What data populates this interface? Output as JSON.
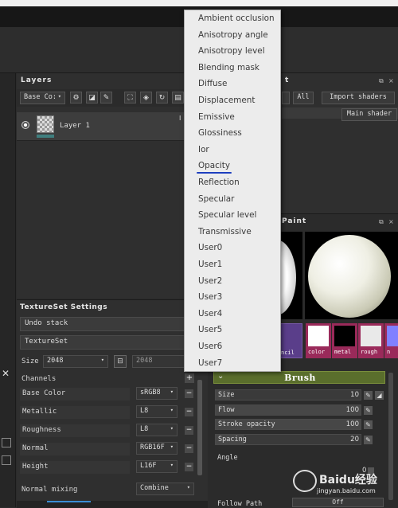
{
  "layers_panel": {
    "title": "Layers",
    "channel_select": "Base Co:",
    "layer_name": "Layer 1",
    "marker": "I"
  },
  "texture_panel": {
    "title": "TextureSet Settings",
    "undo_stack": "Undo stack",
    "textureset": "TextureSet",
    "size_label": "Size",
    "size_value": "2048",
    "size_value2": "2048",
    "channels_label": "Channels",
    "channels": [
      {
        "name": "Base Color",
        "format": "sRGB8"
      },
      {
        "name": "Metallic",
        "format": "L8"
      },
      {
        "name": "Roughness",
        "format": "L8"
      },
      {
        "name": "Normal",
        "format": "RGB16F"
      },
      {
        "name": "Height",
        "format": "L16F"
      }
    ],
    "normal_mixing_label": "Normal mixing",
    "normal_mixing_value": "Combine"
  },
  "shelf_panel": {
    "title_fragment": "t",
    "filter_all": "All",
    "import_shaders": "Import shaders",
    "main_shader": "Main shader"
  },
  "paint_panel": {
    "title_fragment": "Paint",
    "channel_labels": [
      "ncil",
      "color",
      "metal",
      "rough",
      "n"
    ]
  },
  "brush": {
    "title": "Brush",
    "sliders": [
      {
        "label": "Size",
        "value": "10",
        "fill": 0.1
      },
      {
        "label": "Flow",
        "value": "100",
        "fill": 1.0
      },
      {
        "label": "Stroke opacity",
        "value": "100",
        "fill": 1.0
      },
      {
        "label": "Spacing",
        "value": "20",
        "fill": 0.2
      }
    ],
    "angle_label": "Angle",
    "angle_value": "0",
    "follow_path_label": "Follow Path",
    "follow_path_value": "Off"
  },
  "dropdown_menu": {
    "items": [
      "Ambient occlusion",
      "Anisotropy angle",
      "Anisotropy level",
      "Blending mask",
      "Diffuse",
      "Displacement",
      "Emissive",
      "Glossiness",
      "Ior",
      "Opacity",
      "Reflection",
      "Specular",
      "Specular level",
      "Transmissive",
      "User0",
      "User1",
      "User2",
      "User3",
      "User4",
      "User5",
      "User6",
      "User7"
    ],
    "highlighted": "Opacity"
  },
  "watermark": {
    "text": "Baidu经验",
    "url": "jingyan.baidu.com"
  },
  "colors": {
    "accent_underline": "#1e3fbf",
    "brush_header": "#5a6e2c",
    "menu_bg": "#ececec"
  }
}
